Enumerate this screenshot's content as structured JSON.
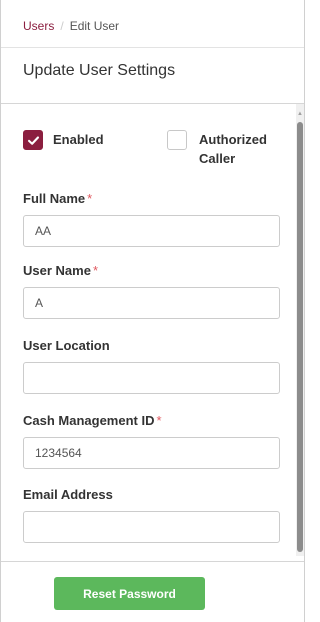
{
  "breadcrumb": {
    "parent": "Users",
    "separator": "/",
    "current": "Edit User"
  },
  "page_title": "Update User Settings",
  "checkboxes": [
    {
      "label": "Enabled",
      "checked": true
    },
    {
      "label": "Authorized Caller",
      "checked": false
    }
  ],
  "fields": {
    "full_name": {
      "label": "Full Name",
      "required_mark": "*",
      "value": "AA"
    },
    "user_name": {
      "label": "User Name",
      "required_mark": "*",
      "value": "A"
    },
    "user_location": {
      "label": "User Location",
      "value": ""
    },
    "cash_management_id": {
      "label": "Cash Management ID",
      "required_mark": "*",
      "value": "1234564"
    },
    "email_address": {
      "label": "Email Address",
      "value": ""
    }
  },
  "footer": {
    "reset_password_label": "Reset Password"
  },
  "colors": {
    "accent": "#8b1e3f",
    "required": "#e0585f",
    "button_green": "#5cb85c"
  }
}
